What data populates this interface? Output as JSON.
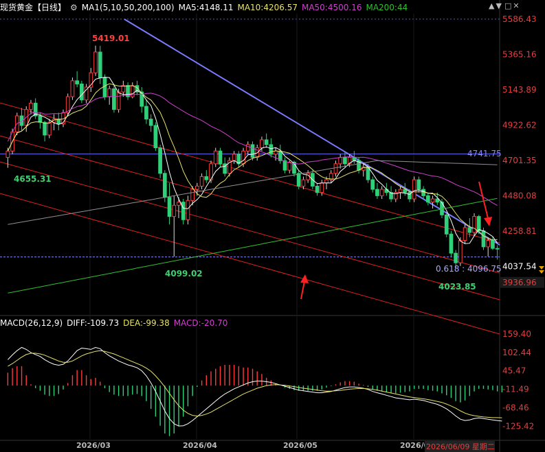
{
  "header": {
    "instrument": "现货黄金【日线】",
    "settings_icon": "gear-icon",
    "ma_label": "MA1(5,10,50,200,100)",
    "ma5": "MA5:4148.11",
    "ma10": "MA10:4206.57",
    "ma50": "MA50:4500.16",
    "ma200": "MA200:44",
    "right_icons": [
      "chevron-up-icon",
      "chevron-down-icon",
      "window-icon",
      "close-icon"
    ]
  },
  "macd_header": {
    "label": "MACD(26,12,9)",
    "diff": "DIFF:-109.73",
    "dea": "DEA:-99.38",
    "macd": "MACD:-20.70"
  },
  "annotations": {
    "high": "5419.01",
    "low_left": "4655.31",
    "low_mid": "4099.02",
    "low_right": "4023.85",
    "hline_label": "4741.75",
    "fib_label": "0.618 : 4096.75",
    "date_box": "2026/06/09 星期二"
  },
  "colors": {
    "up": "#ff3b3b",
    "down": "#30d07a",
    "ma5": "#ffffff",
    "ma10": "#e8e46a",
    "ma50": "#d040d0",
    "ma200": "#30c030",
    "ma100": "#909090",
    "trendline": "#7b7bff",
    "channel": "#e02020",
    "arrow": "#ff2020"
  },
  "chart_data": [
    {
      "type": "candlestick",
      "price_axis": [
        "5586.43",
        "5365.16",
        "5143.89",
        "4922.62",
        "4701.35",
        "4480.08",
        "4258.81",
        "4037.54",
        "3936.96"
      ],
      "x_tick_labels": [
        "2026/03",
        "2026/04",
        "2026/05",
        "2026/0"
      ],
      "ylim": [
        3850,
        5620
      ],
      "horizontal_line": 4741.75,
      "fib_line": 4096.75,
      "ohlc": [
        [
          4720,
          4780,
          4655,
          4760
        ],
        [
          4760,
          4900,
          4740,
          4880
        ],
        [
          4880,
          5000,
          4860,
          4980
        ],
        [
          4980,
          5030,
          4890,
          4920
        ],
        [
          4920,
          5040,
          4880,
          5020
        ],
        [
          5020,
          5080,
          4990,
          5060
        ],
        [
          5060,
          5090,
          4960,
          4980
        ],
        [
          4980,
          5000,
          4900,
          4940
        ],
        [
          4940,
          4950,
          4820,
          4860
        ],
        [
          4860,
          4960,
          4840,
          4940
        ],
        [
          4940,
          4990,
          4890,
          4960
        ],
        [
          4960,
          5000,
          4890,
          4930
        ],
        [
          4930,
          5020,
          4910,
          5000
        ],
        [
          5000,
          5120,
          4980,
          5100
        ],
        [
          5100,
          5220,
          5080,
          5200
        ],
        [
          5200,
          5260,
          5160,
          5180
        ],
        [
          5180,
          5200,
          5060,
          5080
        ],
        [
          5080,
          5180,
          5060,
          5160
        ],
        [
          5160,
          5280,
          5130,
          5250
        ],
        [
          5250,
          5420,
          5230,
          5380
        ],
        [
          5380,
          5419,
          5180,
          5220
        ],
        [
          5220,
          5240,
          5080,
          5100
        ],
        [
          5100,
          5170,
          5050,
          5150
        ],
        [
          5150,
          5180,
          5000,
          5020
        ],
        [
          5020,
          5150,
          5000,
          5130
        ],
        [
          5130,
          5200,
          5100,
          5170
        ],
        [
          5170,
          5190,
          5080,
          5100
        ],
        [
          5100,
          5190,
          5090,
          5170
        ],
        [
          5170,
          5200,
          5110,
          5130
        ],
        [
          5130,
          5160,
          5000,
          5040
        ],
        [
          5040,
          5080,
          4930,
          4960
        ],
        [
          4960,
          4990,
          4880,
          4920
        ],
        [
          4920,
          4940,
          4760,
          4780
        ],
        [
          4780,
          4800,
          4590,
          4620
        ],
        [
          4620,
          4640,
          4440,
          4470
        ],
        [
          4470,
          4560,
          4300,
          4350
        ],
        [
          4350,
          4480,
          4099,
          4420
        ],
        [
          4420,
          4470,
          4340,
          4440
        ],
        [
          4440,
          4460,
          4300,
          4330
        ],
        [
          4330,
          4480,
          4300,
          4450
        ],
        [
          4450,
          4540,
          4420,
          4520
        ],
        [
          4520,
          4560,
          4480,
          4540
        ],
        [
          4540,
          4620,
          4520,
          4600
        ],
        [
          4600,
          4640,
          4560,
          4580
        ],
        [
          4580,
          4700,
          4560,
          4680
        ],
        [
          4680,
          4780,
          4660,
          4760
        ],
        [
          4760,
          4780,
          4660,
          4680
        ],
        [
          4680,
          4720,
          4600,
          4620
        ],
        [
          4620,
          4720,
          4600,
          4700
        ],
        [
          4700,
          4760,
          4680,
          4740
        ],
        [
          4740,
          4760,
          4660,
          4680
        ],
        [
          4680,
          4780,
          4660,
          4760
        ],
        [
          4760,
          4820,
          4740,
          4800
        ],
        [
          4800,
          4820,
          4700,
          4720
        ],
        [
          4720,
          4800,
          4700,
          4780
        ],
        [
          4780,
          4850,
          4760,
          4830
        ],
        [
          4830,
          4870,
          4780,
          4800
        ],
        [
          4800,
          4840,
          4720,
          4740
        ],
        [
          4740,
          4780,
          4700,
          4760
        ],
        [
          4760,
          4800,
          4680,
          4700
        ],
        [
          4700,
          4720,
          4620,
          4640
        ],
        [
          4640,
          4700,
          4620,
          4690
        ],
        [
          4690,
          4700,
          4600,
          4620
        ],
        [
          4620,
          4640,
          4520,
          4540
        ],
        [
          4540,
          4600,
          4520,
          4580
        ],
        [
          4580,
          4640,
          4560,
          4620
        ],
        [
          4620,
          4640,
          4520,
          4540
        ],
        [
          4540,
          4560,
          4480,
          4500
        ],
        [
          4500,
          4580,
          4480,
          4560
        ],
        [
          4560,
          4600,
          4520,
          4580
        ],
        [
          4580,
          4640,
          4560,
          4620
        ],
        [
          4620,
          4700,
          4600,
          4680
        ],
        [
          4680,
          4740,
          4650,
          4720
        ],
        [
          4720,
          4750,
          4660,
          4680
        ],
        [
          4680,
          4740,
          4660,
          4720
        ],
        [
          4720,
          4760,
          4680,
          4700
        ],
        [
          4700,
          4720,
          4620,
          4640
        ],
        [
          4640,
          4680,
          4600,
          4660
        ],
        [
          4660,
          4680,
          4560,
          4580
        ],
        [
          4580,
          4600,
          4500,
          4520
        ],
        [
          4520,
          4560,
          4460,
          4480
        ],
        [
          4480,
          4540,
          4460,
          4520
        ],
        [
          4520,
          4560,
          4480,
          4500
        ],
        [
          4500,
          4540,
          4440,
          4460
        ],
        [
          4460,
          4520,
          4440,
          4500
        ],
        [
          4500,
          4540,
          4460,
          4520
        ],
        [
          4520,
          4560,
          4480,
          4500
        ],
        [
          4500,
          4520,
          4440,
          4460
        ],
        [
          4460,
          4600,
          4440,
          4580
        ],
        [
          4580,
          4600,
          4500,
          4520
        ],
        [
          4520,
          4540,
          4460,
          4480
        ],
        [
          4480,
          4500,
          4420,
          4440
        ],
        [
          4440,
          4480,
          4400,
          4460
        ],
        [
          4460,
          4500,
          4420,
          4440
        ],
        [
          4440,
          4460,
          4340,
          4360
        ],
        [
          4360,
          4380,
          4220,
          4240
        ],
        [
          4240,
          4260,
          4100,
          4120
        ],
        [
          4120,
          4140,
          4024,
          4060
        ],
        [
          4060,
          4220,
          4040,
          4200
        ],
        [
          4200,
          4300,
          4180,
          4280
        ],
        [
          4280,
          4340,
          4220,
          4250
        ],
        [
          4250,
          4370,
          4230,
          4350
        ],
        [
          4350,
          4360,
          4240,
          4260
        ],
        [
          4260,
          4280,
          4140,
          4160
        ],
        [
          4160,
          4220,
          4100,
          4200
        ],
        [
          4200,
          4220,
          4140,
          4150
        ],
        [
          4150,
          4170,
          4080,
          4148
        ]
      ]
    },
    {
      "type": "bar",
      "name": "MACD",
      "macd_axis": [
        "159.40",
        "102.44",
        "45.47",
        "-11.49",
        "-68.46",
        "-125.42"
      ],
      "ylim": [
        -165,
        170
      ],
      "diff": [
        80,
        95,
        108,
        118,
        112,
        102,
        96,
        90,
        80,
        72,
        66,
        63,
        66,
        76,
        92,
        108,
        116,
        114,
        112,
        118,
        114,
        102,
        92,
        84,
        76,
        70,
        64,
        60,
        55,
        46,
        30,
        8,
        -18,
        -48,
        -78,
        -102,
        -118,
        -125,
        -124,
        -118,
        -108,
        -96,
        -84,
        -72,
        -60,
        -48,
        -36,
        -26,
        -18,
        -10,
        -4,
        2,
        8,
        12,
        14,
        14,
        12,
        10,
        6,
        2,
        -2,
        -6,
        -10,
        -14,
        -16,
        -18,
        -20,
        -22,
        -22,
        -20,
        -18,
        -14,
        -10,
        -6,
        -4,
        -4,
        -6,
        -8,
        -12,
        -18,
        -22,
        -26,
        -30,
        -34,
        -38,
        -40,
        -42,
        -44,
        -42,
        -44,
        -46,
        -50,
        -54,
        -58,
        -64,
        -72,
        -82,
        -94,
        -104,
        -108,
        -106,
        -102,
        -100,
        -102,
        -104,
        -106,
        -108,
        -109.73
      ],
      "dea": [
        60,
        68,
        78,
        88,
        96,
        100,
        100,
        98,
        94,
        88,
        82,
        76,
        72,
        72,
        76,
        84,
        92,
        98,
        102,
        106,
        108,
        106,
        102,
        98,
        92,
        86,
        80,
        74,
        68,
        62,
        54,
        44,
        30,
        14,
        -4,
        -24,
        -44,
        -62,
        -76,
        -86,
        -92,
        -94,
        -92,
        -88,
        -82,
        -74,
        -66,
        -58,
        -50,
        -42,
        -34,
        -26,
        -20,
        -14,
        -8,
        -4,
        0,
        2,
        3,
        2,
        1,
        -1,
        -3,
        -6,
        -8,
        -10,
        -12,
        -14,
        -16,
        -17,
        -17,
        -16,
        -15,
        -13,
        -11,
        -10,
        -9,
        -9,
        -10,
        -12,
        -14,
        -17,
        -20,
        -23,
        -26,
        -29,
        -32,
        -35,
        -37,
        -39,
        -41,
        -43,
        -46,
        -49,
        -52,
        -57,
        -63,
        -70,
        -78,
        -85,
        -90,
        -93,
        -95,
        -97,
        -98,
        -99,
        -99,
        -99.38
      ],
      "values": [
        40,
        54,
        60,
        60,
        32,
        4,
        -8,
        -16,
        -28,
        -32,
        -32,
        -26,
        -12,
        8,
        32,
        48,
        48,
        32,
        20,
        24,
        12,
        -8,
        -20,
        -28,
        -32,
        -32,
        -32,
        -28,
        -26,
        -32,
        -48,
        -72,
        -96,
        -124,
        -148,
        -156,
        -148,
        -126,
        -96,
        -64,
        -32,
        -4,
        16,
        32,
        44,
        52,
        60,
        64,
        64,
        64,
        60,
        56,
        56,
        52,
        44,
        36,
        24,
        16,
        6,
        0,
        -6,
        -10,
        -14,
        -16,
        -16,
        -16,
        -16,
        -16,
        -12,
        -6,
        -2,
        4,
        10,
        14,
        14,
        12,
        6,
        2,
        -4,
        -12,
        -16,
        -18,
        -20,
        -22,
        -24,
        -22,
        -20,
        -18,
        -10,
        -10,
        -10,
        -14,
        -16,
        -18,
        -24,
        -30,
        -38,
        -48,
        -52,
        -46,
        -32,
        -18,
        -10,
        -10,
        -12,
        -14,
        -18,
        -20.7
      ]
    }
  ]
}
